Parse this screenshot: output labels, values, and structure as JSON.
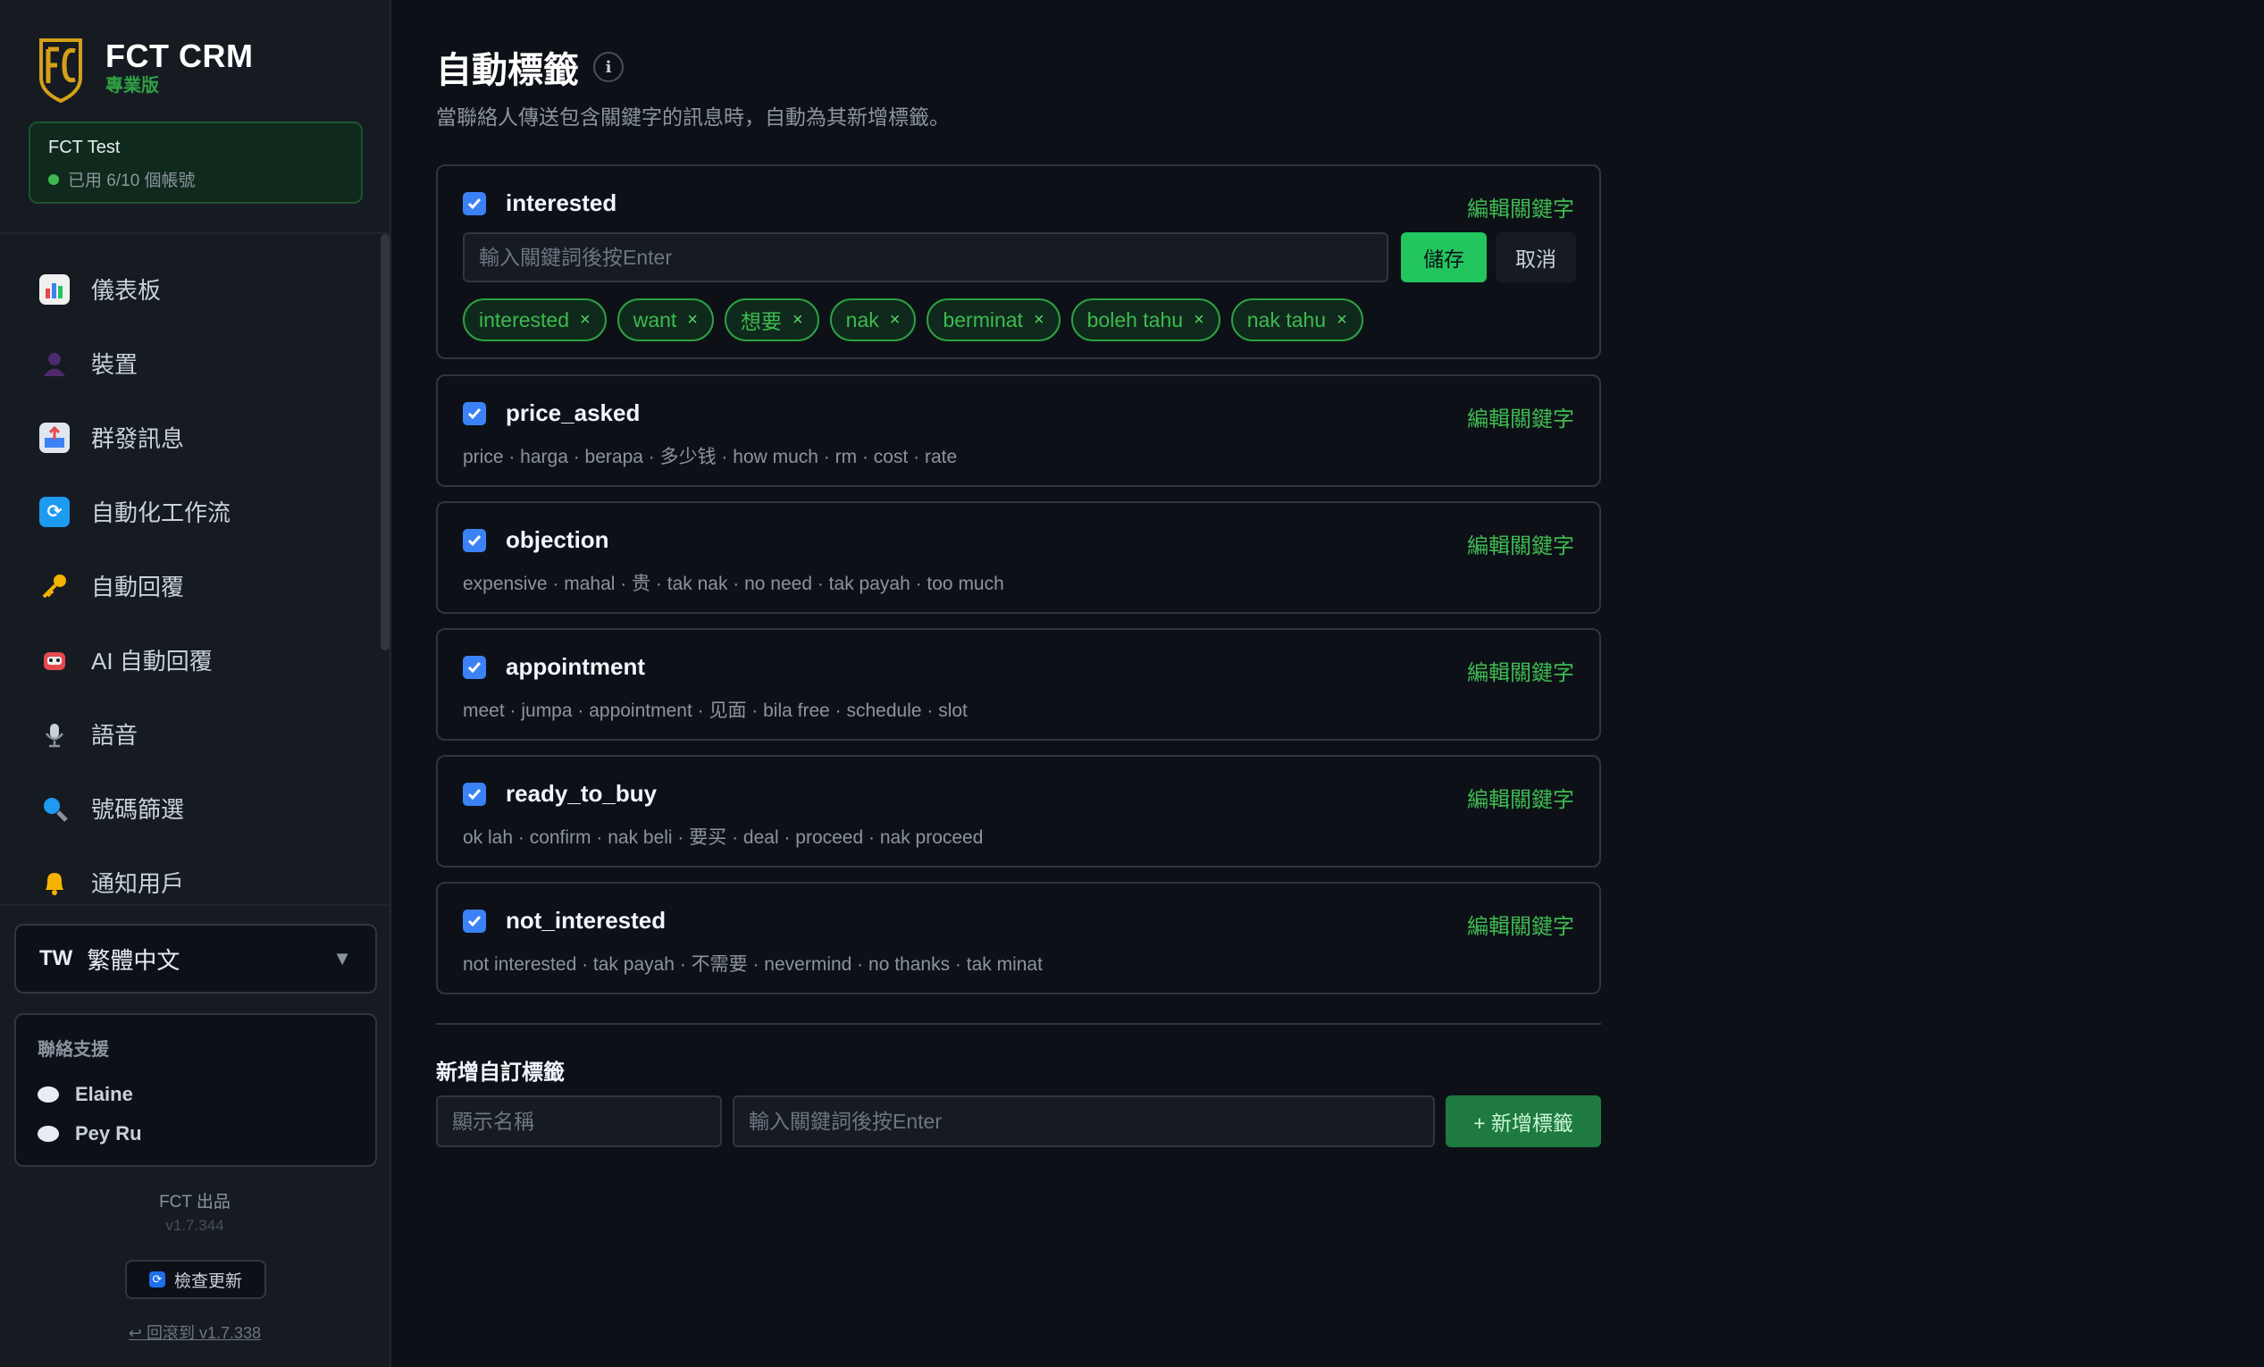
{
  "brand": {
    "title": "FCT CRM",
    "edition": "專業版"
  },
  "account": {
    "name": "FCT Test",
    "usage": "已用 6/10 個帳號"
  },
  "nav": [
    {
      "label": "儀表板",
      "icon": "bar-chart-icon",
      "color": "#e5484d"
    },
    {
      "label": "裝置",
      "icon": "user-silhouette-icon",
      "color": "#4c2a6b"
    },
    {
      "label": "群發訊息",
      "icon": "outbox-tray-icon",
      "color": "#3b82f6"
    },
    {
      "label": "自動化工作流",
      "icon": "refresh-arrows-icon",
      "color": "#1d9bf0"
    },
    {
      "label": "自動回覆",
      "icon": "key-icon",
      "color": "#f5b301"
    },
    {
      "label": "AI 自動回覆",
      "icon": "robot-icon",
      "color": "#e5484d"
    },
    {
      "label": "語音",
      "icon": "microphone-icon",
      "color": "#8b949e"
    },
    {
      "label": "號碼篩選",
      "icon": "magnifier-icon",
      "color": "#1d9bf0"
    },
    {
      "label": "通知用戶",
      "icon": "bell-icon",
      "color": "#f5b301"
    }
  ],
  "language": {
    "code": "TW",
    "label": "繁體中文"
  },
  "support": {
    "title": "聯絡支援",
    "contacts": [
      "Elaine",
      "Pey Ru"
    ]
  },
  "footer": {
    "made_by": "FCT 出品",
    "version": "v1.7.344",
    "update_label": "檢查更新",
    "rollback_label": "↩ 回滾到 v1.7.338"
  },
  "page": {
    "title": "自動標籤",
    "description": "當聯絡人傳送包含關鍵字的訊息時，自動為其新增標籤。",
    "edit_label": "編輯關鍵字"
  },
  "editing": {
    "input_placeholder": "輸入關鍵詞後按Enter",
    "save_label": "儲存",
    "cancel_label": "取消"
  },
  "tags": [
    {
      "name": "interested",
      "checked": true,
      "editing": true,
      "keywords": [
        "interested",
        "want",
        "想要",
        "nak",
        "berminat",
        "boleh tahu",
        "nak tahu"
      ]
    },
    {
      "name": "price_asked",
      "checked": true,
      "keywords_text": "price · harga · berapa · 多少钱 · how much · rm · cost · rate"
    },
    {
      "name": "objection",
      "checked": true,
      "keywords_text": "expensive · mahal · 贵 · tak nak · no need · tak payah · too much"
    },
    {
      "name": "appointment",
      "checked": true,
      "keywords_text": "meet · jumpa · appointment · 见面 · bila free · schedule · slot"
    },
    {
      "name": "ready_to_buy",
      "checked": true,
      "keywords_text": "ok lah · confirm · nak beli · 要买 · deal · proceed · nak proceed"
    },
    {
      "name": "not_interested",
      "checked": true,
      "keywords_text": "not interested · tak payah · 不需要 · nevermind · no thanks · tak minat"
    }
  ],
  "new_tag": {
    "title": "新增自訂標籤",
    "name_placeholder": "顯示名稱",
    "keywords_placeholder": "輸入關鍵詞後按Enter",
    "add_label": "+ 新增標籤"
  },
  "colors": {
    "accent": "#3fb950",
    "checkbox": "#3b82f6",
    "background": "#0d1117",
    "sidebar": "#161b22"
  }
}
